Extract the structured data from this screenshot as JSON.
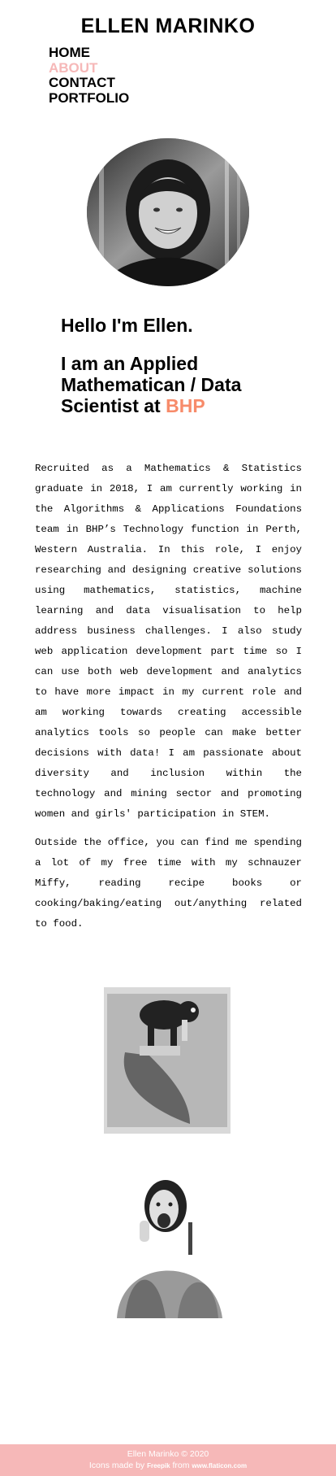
{
  "site": {
    "title": "ELLEN MARINKO"
  },
  "nav": {
    "items": [
      "HOME",
      "ABOUT",
      "CONTACT",
      "PORTFOLIO"
    ]
  },
  "intro": {
    "greeting": "Hello I'm Ellen.",
    "role_prefix": "I am an Applied Mathematican / Data Scientist at ",
    "employer": "BHP"
  },
  "bio": {
    "paragraph1": "Recruited as a Mathematics & Statistics graduate in 2018, I am currently working in the Algorithms & Applications Foundations team in BHP’s Technology function in Perth, Western Australia. In this role, I enjoy researching and designing creative solutions using mathematics, statistics, machine learning and data visualisation to help address business challenges. I also study web application development part time so I can use both web development and analytics to have more impact in my current role and am working towards creating accessible analytics tools so people can make better decisions with data! I am passionate about diversity and inclusion within the technology and mining sector and promoting women and girls' participation in STEM.",
    "paragraph2": "Outside the office, you can find me spending a lot of my free time with my schnauzer Miffy, reading recipe books or cooking/baking/eating out/anything related to food."
  },
  "footer": {
    "copyright": "Ellen Marinko © 2020",
    "credit_prefix": "Icons made by ",
    "credit_author": "Freepik",
    "credit_middle": " from ",
    "credit_site": "www.flaticon.com"
  },
  "colors": {
    "accent": "#f78b6a",
    "active_nav": "#f6b8b8",
    "footer_bg": "#f6b8b8"
  }
}
